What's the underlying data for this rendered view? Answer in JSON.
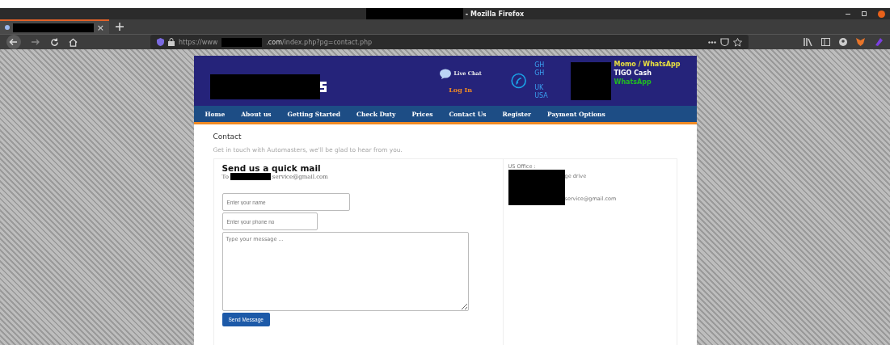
{
  "window": {
    "title": "- Mozilla Firefox"
  },
  "tabs": [
    {
      "label": "×",
      "selected": true
    }
  ],
  "address_bar": {
    "prefix": "https://www",
    "suffix": ".com/index.php?pg=contact.php"
  },
  "site_header": {
    "live_chat": "Live Chat",
    "login": "Log In",
    "phone_groups": [
      [
        "GH",
        "GH"
      ],
      [
        "UK",
        "USA"
      ]
    ],
    "payments": [
      {
        "label": "Momo / WhatsApp",
        "color": "#e8e040"
      },
      {
        "label": "TIGO Cash",
        "color": "#ffffff"
      },
      {
        "label": "WhatsApp",
        "color": "#22bb22"
      }
    ]
  },
  "nav": [
    {
      "label": "Home"
    },
    {
      "label": "About us"
    },
    {
      "label": "Getting Started"
    },
    {
      "label": "Check Duty"
    },
    {
      "label": "Prices"
    },
    {
      "label": "Contact Us"
    },
    {
      "label": "Register"
    },
    {
      "label": "Payment Options"
    }
  ],
  "page": {
    "title": "Contact",
    "subtitle": "Get in touch with Automasters, we'll be glad to hear from you.",
    "form": {
      "heading": "Send us a quick mail",
      "to_label": "To",
      "to_email": "service@gmail.com",
      "name_placeholder": "Enter your name",
      "phone_placeholder": "Enter your phone no",
      "message_placeholder": "Type your message ...",
      "submit": "Send Message"
    },
    "office": {
      "label": "US Office :",
      "street": "ge drive",
      "email": "service@gmail.com"
    }
  }
}
